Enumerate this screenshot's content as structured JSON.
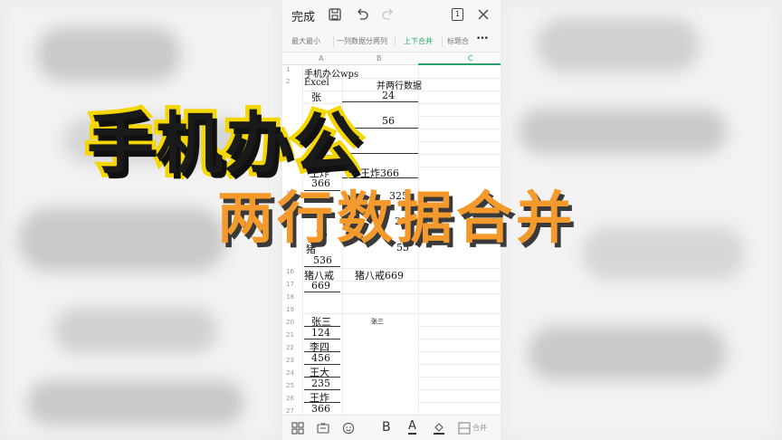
{
  "topbar": {
    "done_label": "完成",
    "icons": [
      "save-icon",
      "undo-icon",
      "redo-icon",
      "page-count-icon",
      "close-icon"
    ],
    "page_count": "1"
  },
  "toolbar2": {
    "items": [
      "最大最小",
      "一列数据分两列",
      "上下合并",
      "标题合"
    ],
    "active_index": 2,
    "more": "•••"
  },
  "sheet": {
    "columns": [
      "A",
      "B",
      "C"
    ],
    "rows": [
      "1",
      "2",
      "3",
      "4",
      "5",
      "6",
      "7",
      "8",
      "9",
      "10",
      "11",
      "12",
      "13",
      "14",
      "15",
      "16",
      "17",
      "18",
      "19",
      "20",
      "21",
      "22",
      "23",
      "24",
      "25",
      "26",
      "27",
      "28",
      "29"
    ],
    "cells": {
      "a1": "手机办公wps",
      "a2": "Excel",
      "b2": "并两行数据",
      "a3": "张",
      "b3": "24",
      "b5": "56",
      "a7": "9",
      "a8": "235",
      "a9": "王炸",
      "b9": "王炸366",
      "a10": "366",
      "b11": "325",
      "b13": "22",
      "a14": "16",
      "a15": "猪",
      "b15": "53",
      "a16": "536",
      "a17": "猪八戒",
      "b17": "猪八戒669",
      "a18": "669",
      "a21": "张三",
      "b21": "张三",
      "a22": "124",
      "a23": "李四",
      "a24": "456",
      "a25": "王大",
      "a26": "235",
      "a27": "王炸",
      "a28": "366"
    }
  },
  "bottombar": {
    "icons": [
      "grid-icon",
      "keyboard-icon",
      "emoji-icon",
      "bold-icon",
      "font-color-icon",
      "fill-color-icon",
      "merge-cells-icon"
    ],
    "bold_label": "B",
    "font_label": "A",
    "merge_label": "合并"
  },
  "captions": {
    "line1": "手机办公",
    "line2": "两行数据合并"
  },
  "colors": {
    "accent": "#2aa36b",
    "caption1_fill": "#1a1a1a",
    "caption1_stroke": "#f4d600",
    "caption2_fill": "#f49a2c"
  }
}
